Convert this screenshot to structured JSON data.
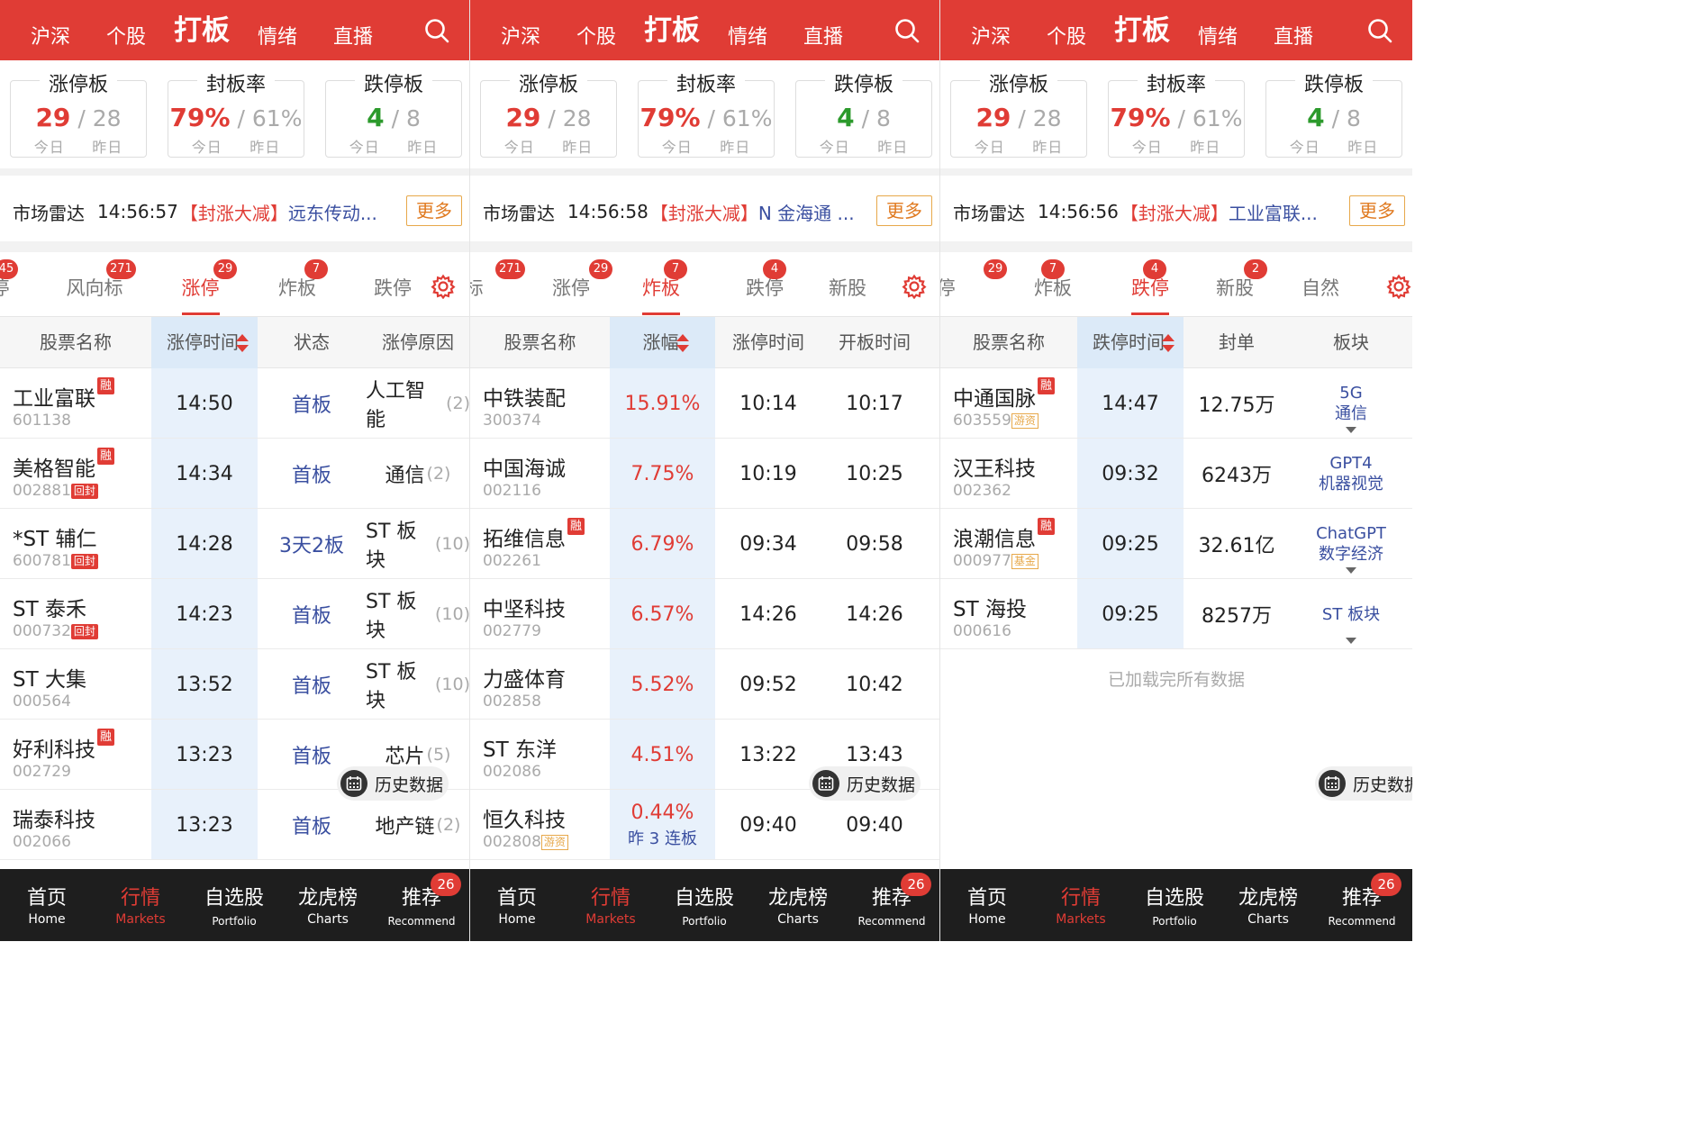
{
  "search_icon": "search-icon",
  "screens": [
    {
      "nav": [
        "沪深",
        "个股",
        "打板",
        "情绪",
        "直播"
      ],
      "active_nav": 2,
      "cards": [
        {
          "title": "涨停板",
          "today": "29",
          "yesterday": "28",
          "label_today": "今日",
          "label_yesterday": "昨日",
          "color": "red"
        },
        {
          "title": "封板率",
          "today": "79%",
          "yesterday": "61%",
          "label_today": "今日",
          "label_yesterday": "昨日",
          "color": "red"
        },
        {
          "title": "跌停板",
          "today": "4",
          "yesterday": "8",
          "label_today": "今日",
          "label_yesterday": "昨日",
          "color": "green"
        }
      ],
      "radar": {
        "label": "市场雷达",
        "time": "14:56:57",
        "tag": "【封涨大减】",
        "name": "远东传动...",
        "more": "更多"
      },
      "tabs": [
        {
          "label": "停",
          "badge": "45"
        },
        {
          "label": "风向标",
          "badge": "271"
        },
        {
          "label": "涨停",
          "badge": "29",
          "active": true
        },
        {
          "label": "炸板",
          "badge": "7"
        },
        {
          "label": "跌停",
          "badge": ""
        }
      ],
      "headers": [
        "股票名称",
        "涨停时间",
        "状态",
        "涨停原因"
      ],
      "rows": [
        {
          "name": "工业富联",
          "code": "601138",
          "rong": "融",
          "flag": "",
          "time": "14:50",
          "status": "首板",
          "reason": "人工智能",
          "count": "(2)"
        },
        {
          "name": "美格智能",
          "code": "002881",
          "rong": "融",
          "flag": "回封",
          "time": "14:34",
          "status": "首板",
          "reason": "通信",
          "count": "(2)"
        },
        {
          "name": "*ST 辅仁",
          "code": "600781",
          "rong": "",
          "flag": "回封",
          "time": "14:28",
          "status": "3天2板",
          "reason": "ST 板块",
          "count": "(10)"
        },
        {
          "name": "ST 泰禾",
          "code": "000732",
          "rong": "",
          "flag": "回封",
          "time": "14:23",
          "status": "首板",
          "reason": "ST 板块",
          "count": "(10)"
        },
        {
          "name": "ST 大集",
          "code": "000564",
          "rong": "",
          "flag": "",
          "time": "13:52",
          "status": "首板",
          "reason": "ST 板块",
          "count": "(10)"
        },
        {
          "name": "好利科技",
          "code": "002729",
          "rong": "融",
          "flag": "",
          "time": "13:23",
          "status": "首板",
          "reason": "芯片",
          "count": "(5)"
        },
        {
          "name": "瑞泰科技",
          "code": "002066",
          "rong": "",
          "flag": "",
          "time": "13:23",
          "status": "首板",
          "reason": "地产链",
          "count": "(2)"
        }
      ],
      "history": "历史数据",
      "bottom": [
        {
          "zh": "首页",
          "en": "Home"
        },
        {
          "zh": "行情",
          "en": "Markets",
          "active": true
        },
        {
          "zh": "自选股",
          "en": "Portfolio"
        },
        {
          "zh": "龙虎榜",
          "en": "Charts"
        },
        {
          "zh": "推荐",
          "en": "Recommend",
          "badge": "26"
        }
      ]
    },
    {
      "nav": [
        "沪深",
        "个股",
        "打板",
        "情绪",
        "直播"
      ],
      "active_nav": 2,
      "cards": [
        {
          "title": "涨停板",
          "today": "29",
          "yesterday": "28",
          "label_today": "今日",
          "label_yesterday": "昨日",
          "color": "red"
        },
        {
          "title": "封板率",
          "today": "79%",
          "yesterday": "61%",
          "label_today": "今日",
          "label_yesterday": "昨日",
          "color": "red"
        },
        {
          "title": "跌停板",
          "today": "4",
          "yesterday": "8",
          "label_today": "今日",
          "label_yesterday": "昨日",
          "color": "green"
        }
      ],
      "radar": {
        "label": "市场雷达",
        "time": "14:56:58",
        "tag": "【封涨大减】",
        "name": "N 金海通 ...",
        "more": "更多"
      },
      "tabs": [
        {
          "label": "]标",
          "badge": "271"
        },
        {
          "label": "涨停",
          "badge": "29"
        },
        {
          "label": "炸板",
          "badge": "7",
          "active": true
        },
        {
          "label": "跌停",
          "badge": "4"
        },
        {
          "label": "新股",
          "badge": ""
        }
      ],
      "headers": [
        "股票名称",
        "涨幅",
        "涨停时间",
        "开板时间"
      ],
      "rows": [
        {
          "name": "中铁装配",
          "code": "300374",
          "rong": "",
          "tag": "",
          "pct": "15.91%",
          "sub": "",
          "t1": "10:14",
          "t2": "10:17"
        },
        {
          "name": "中国海诚",
          "code": "002116",
          "rong": "",
          "tag": "",
          "pct": "7.75%",
          "sub": "",
          "t1": "10:19",
          "t2": "10:25"
        },
        {
          "name": "拓维信息",
          "code": "002261",
          "rong": "融",
          "tag": "",
          "pct": "6.79%",
          "sub": "",
          "t1": "09:34",
          "t2": "09:58"
        },
        {
          "name": "中坚科技",
          "code": "002779",
          "rong": "",
          "tag": "",
          "pct": "6.57%",
          "sub": "",
          "t1": "14:26",
          "t2": "14:26"
        },
        {
          "name": "力盛体育",
          "code": "002858",
          "rong": "",
          "tag": "",
          "pct": "5.52%",
          "sub": "",
          "t1": "09:52",
          "t2": "10:42"
        },
        {
          "name": "ST 东洋",
          "code": "002086",
          "rong": "",
          "tag": "",
          "pct": "4.51%",
          "sub": "",
          "t1": "13:22",
          "t2": "13:43"
        },
        {
          "name": "恒久科技",
          "code": "002808",
          "rong": "",
          "tag": "游资",
          "pct": "0.44%",
          "sub": "昨 3 连板",
          "t1": "09:40",
          "t2": "09:40"
        }
      ],
      "history": "历史数据",
      "bottom": [
        {
          "zh": "首页",
          "en": "Home"
        },
        {
          "zh": "行情",
          "en": "Markets",
          "active": true
        },
        {
          "zh": "自选股",
          "en": "Portfolio"
        },
        {
          "zh": "龙虎榜",
          "en": "Charts"
        },
        {
          "zh": "推荐",
          "en": "Recommend",
          "badge": "26"
        }
      ]
    },
    {
      "nav": [
        "沪深",
        "个股",
        "打板",
        "情绪",
        "直播"
      ],
      "active_nav": 2,
      "cards": [
        {
          "title": "涨停板",
          "today": "29",
          "yesterday": "28",
          "label_today": "今日",
          "label_yesterday": "昨日",
          "color": "red"
        },
        {
          "title": "封板率",
          "today": "79%",
          "yesterday": "61%",
          "label_today": "今日",
          "label_yesterday": "昨日",
          "color": "red"
        },
        {
          "title": "跌停板",
          "today": "4",
          "yesterday": "8",
          "label_today": "今日",
          "label_yesterday": "昨日",
          "color": "green"
        }
      ],
      "radar": {
        "label": "市场雷达",
        "time": "14:56:56",
        "tag": "【封涨大减】",
        "name": "工业富联...",
        "more": "更多"
      },
      "tabs": [
        {
          "label": "k停",
          "badge": "29"
        },
        {
          "label": "炸板",
          "badge": "7"
        },
        {
          "label": "跌停",
          "badge": "4",
          "active": true
        },
        {
          "label": "新股",
          "badge": "2"
        },
        {
          "label": "自然",
          "badge": ""
        }
      ],
      "headers": [
        "股票名称",
        "跌停时间",
        "封单",
        "板块"
      ],
      "rows": [
        {
          "name": "中通国脉",
          "code": "603559",
          "rong": "融",
          "tag": "游资",
          "time": "14:47",
          "amount": "12.75万",
          "sector1": "5G",
          "sector2": "通信",
          "arrow": true
        },
        {
          "name": "汉王科技",
          "code": "002362",
          "rong": "",
          "tag": "",
          "time": "09:32",
          "amount": "6243万",
          "sector1": "GPT4",
          "sector2": "机器视觉",
          "arrow": false
        },
        {
          "name": "浪潮信息",
          "code": "000977",
          "rong": "融",
          "tag": "基金",
          "time": "09:25",
          "amount": "32.61亿",
          "sector1": "ChatGPT",
          "sector2": "数字经济",
          "arrow": true
        },
        {
          "name": "ST 海投",
          "code": "000616",
          "rong": "",
          "tag": "",
          "time": "09:25",
          "amount": "8257万",
          "sector1": "ST 板块",
          "sector2": "",
          "arrow": true
        }
      ],
      "loaded": "已加载完所有数据",
      "history": "历史数据",
      "bottom": [
        {
          "zh": "首页",
          "en": "Home"
        },
        {
          "zh": "行情",
          "en": "Markets",
          "active": true
        },
        {
          "zh": "自选股",
          "en": "Portfolio"
        },
        {
          "zh": "龙虎榜",
          "en": "Charts"
        },
        {
          "zh": "推荐",
          "en": "Recommend",
          "badge": "26"
        }
      ]
    }
  ]
}
